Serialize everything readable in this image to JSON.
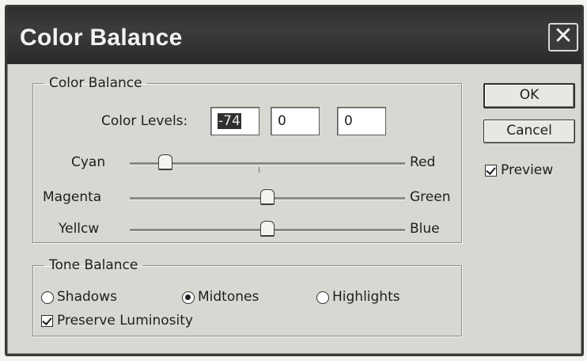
{
  "dialog": {
    "title": "Color Balance",
    "close_glyph": "✕"
  },
  "color_balance": {
    "group_label": "Color Balance",
    "levels_label": "Color Levels:",
    "levels": [
      "-74",
      "0",
      "0"
    ],
    "sliders": [
      {
        "left": "Cyan",
        "right": "Red",
        "value": -74
      },
      {
        "left": "Magenta",
        "right": "Green",
        "value": 0
      },
      {
        "left": "Yellcw",
        "right": "Blue",
        "value": 0
      }
    ],
    "slider_range": [
      -100,
      100
    ]
  },
  "tone_balance": {
    "group_label": "Tone Balance",
    "options": [
      "Shadows",
      "Midtones",
      "Highlights"
    ],
    "selected": "Midtones",
    "preserve_label": "Preserve Luminosity",
    "preserve_checked": true
  },
  "buttons": {
    "ok": "OK",
    "cancel": "Cancel"
  },
  "preview": {
    "label": "Preview",
    "checked": true
  },
  "icons": {
    "close": "close-icon",
    "checkbox": "checkbox-check-icon",
    "radio": "radio-dot-icon",
    "slider_thumb": "slider-thumb-icon"
  },
  "colors": {
    "titlebar": "#2e2e2e",
    "dialog_bg": "#d8d7d2",
    "selection": "#2f2f2f"
  }
}
